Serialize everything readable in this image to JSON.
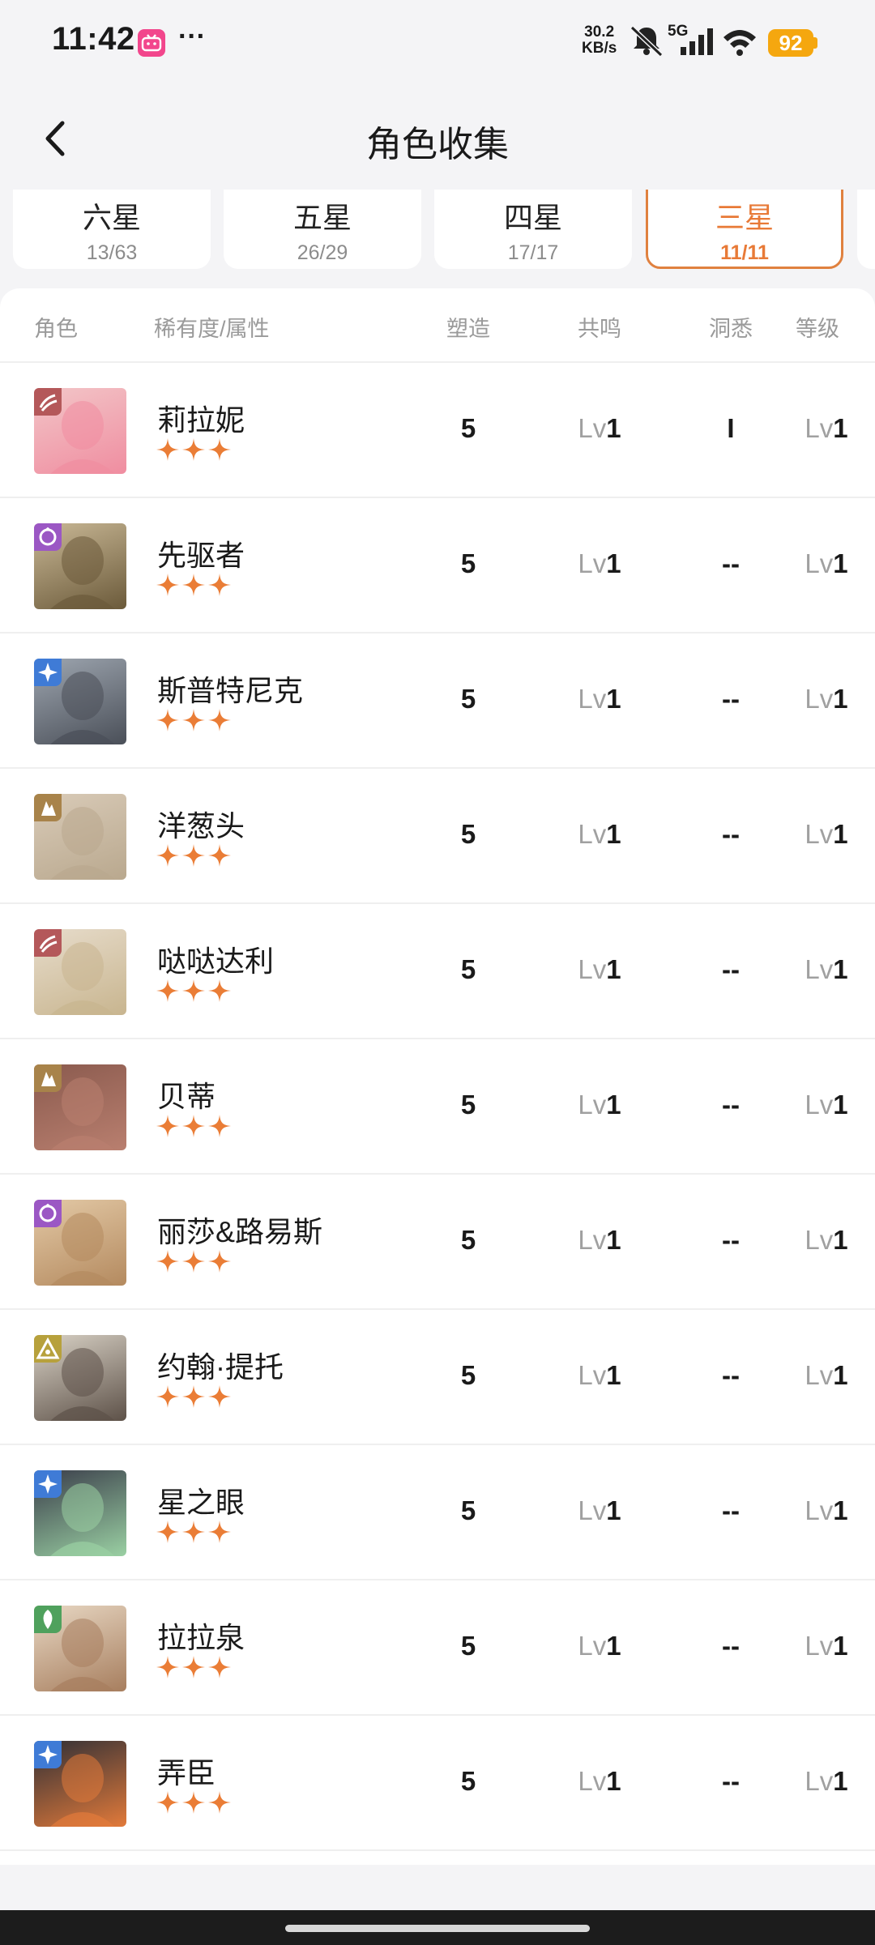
{
  "status_bar": {
    "time": "11:42",
    "app_badge": "bilibili",
    "more": "···",
    "net_speed_value": "30.2",
    "net_speed_unit": "KB/s",
    "network": "5G",
    "battery": "92",
    "icons": [
      "mute-icon",
      "signal-icon",
      "wifi-icon",
      "battery-icon"
    ]
  },
  "header": {
    "title": "角色收集",
    "back_icon": "chevron-left-icon"
  },
  "tabs": [
    {
      "label": "六星",
      "count": "13/63"
    },
    {
      "label": "五星",
      "count": "26/29"
    },
    {
      "label": "四星",
      "count": "17/17"
    },
    {
      "label": "三星",
      "count": "11/11",
      "active": true
    }
  ],
  "table": {
    "headers": {
      "character": "角色",
      "rarity": "稀有度/属性",
      "shaping": "塑造",
      "resonance": "共鸣",
      "insight": "洞悉",
      "level": "等级"
    },
    "lv_prefix": "Lv",
    "rows": [
      {
        "name": "莉拉妮",
        "shaping": "5",
        "resonance": "1",
        "insight": "I",
        "level": "1",
        "element": "beast",
        "element_color": "#b4585a",
        "stars": 3
      },
      {
        "name": "先驱者",
        "shaping": "5",
        "resonance": "1",
        "insight": "--",
        "level": "1",
        "element": "spirit",
        "element_color": "#9b57c4",
        "stars": 3
      },
      {
        "name": "斯普特尼克",
        "shaping": "5",
        "resonance": "1",
        "insight": "--",
        "level": "1",
        "element": "star",
        "element_color": "#3f7bd6",
        "stars": 3
      },
      {
        "name": "洋葱头",
        "shaping": "5",
        "resonance": "1",
        "insight": "--",
        "level": "1",
        "element": "mineral",
        "element_color": "#a8834a",
        "stars": 3
      },
      {
        "name": "哒哒达利",
        "shaping": "5",
        "resonance": "1",
        "insight": "--",
        "level": "1",
        "element": "beast",
        "element_color": "#b4585a",
        "stars": 3
      },
      {
        "name": "贝蒂",
        "shaping": "5",
        "resonance": "1",
        "insight": "--",
        "level": "1",
        "element": "mineral",
        "element_color": "#a8834a",
        "stars": 3
      },
      {
        "name": "丽莎&路易斯",
        "shaping": "5",
        "resonance": "1",
        "insight": "--",
        "level": "1",
        "element": "spirit",
        "element_color": "#9b57c4",
        "stars": 3
      },
      {
        "name": "约翰·提托",
        "shaping": "5",
        "resonance": "1",
        "insight": "--",
        "level": "1",
        "element": "intellect",
        "element_color": "#b7a13c",
        "stars": 3
      },
      {
        "name": "星之眼",
        "shaping": "5",
        "resonance": "1",
        "insight": "--",
        "level": "1",
        "element": "star",
        "element_color": "#3f7bd6",
        "stars": 3
      },
      {
        "name": "拉拉泉",
        "shaping": "5",
        "resonance": "1",
        "insight": "--",
        "level": "1",
        "element": "plant",
        "element_color": "#4fa15d",
        "stars": 3
      },
      {
        "name": "弄臣",
        "shaping": "5",
        "resonance": "1",
        "insight": "--",
        "level": "1",
        "element": "star",
        "element_color": "#3f7bd6",
        "stars": 3
      }
    ]
  },
  "colors": {
    "accent": "#e87a37",
    "star": "#ea7d36",
    "muted": "#9a9a9a"
  }
}
